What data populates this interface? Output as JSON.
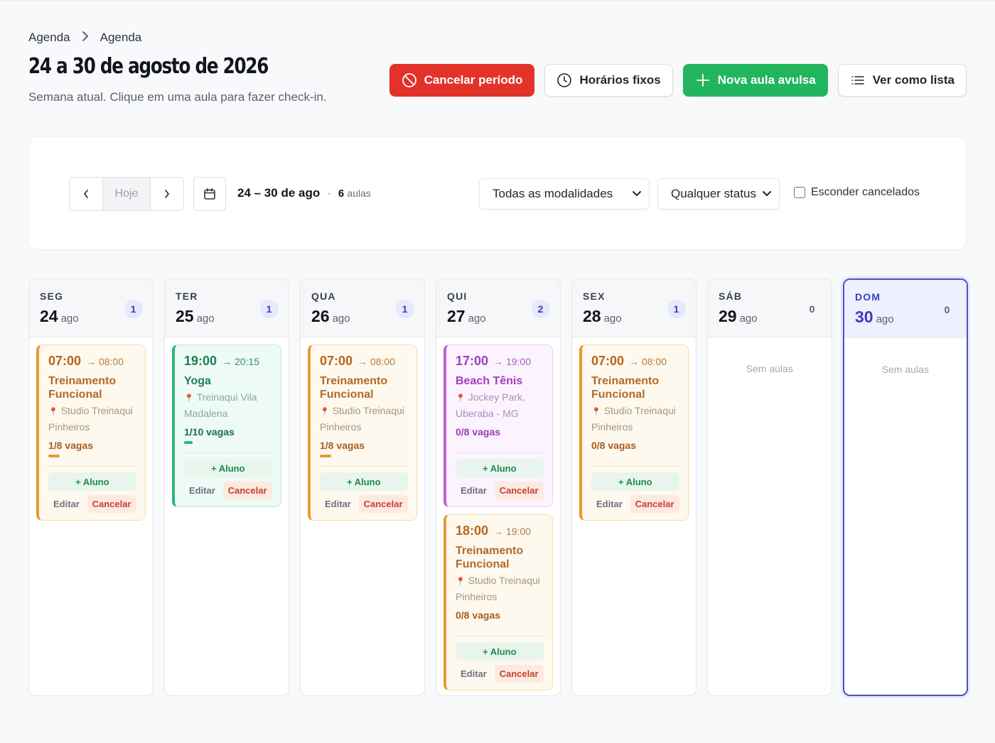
{
  "breadcrumb": {
    "root": "Agenda",
    "current": "Agenda"
  },
  "header": {
    "title": "24 a 30 de agosto de 2026",
    "subtitle": "Semana atual. Clique em uma aula para fazer check-in."
  },
  "actions": {
    "cancel_period": "Cancelar período",
    "fixed_hours": "Horários fixos",
    "new_class": "Nova aula avulsa",
    "view_list": "Ver como lista"
  },
  "filters": {
    "today": "Hoje",
    "range": "24 – 30 de ago",
    "separator": "·",
    "count_num": "6",
    "count_unit": "aulas",
    "modality": "Todas as modalidades",
    "status": "Qualquer status",
    "hide_cancelled": "Esconder cancelados"
  },
  "colors": {
    "accent": "#3a3ec0",
    "danger": "#e2322a",
    "success": "#22b55e",
    "orange": "#e69a34",
    "green": "#2fb57b",
    "purple": "#c45ed8"
  },
  "icons": {
    "cancel": "ban-icon",
    "clock": "clock-icon",
    "plus": "plus-icon",
    "list": "list-icon",
    "calendar": "calendar-icon",
    "prev": "chevron-left-icon",
    "next": "chevron-right-icon"
  },
  "labels": {
    "add_student": "+ Aluno",
    "edit": "Editar",
    "cancel": "Cancelar",
    "no_classes": "Sem aulas"
  },
  "days": [
    {
      "dow": "SEG",
      "num": "24",
      "month": "ago",
      "count": "1",
      "classes": [
        {
          "color": "orange",
          "start": "07:00",
          "end": "→ 08:00",
          "title": "Treinamento Funcional",
          "location": "Studio Treinaqui Pinheiros",
          "vagas": "1/8 vagas",
          "fill": 0.125
        }
      ]
    },
    {
      "dow": "TER",
      "num": "25",
      "month": "ago",
      "count": "1",
      "classes": [
        {
          "color": "green",
          "start": "19:00",
          "end": "→ 20:15",
          "title": "Yoga",
          "location": "Treinaqui Vila Madalena",
          "vagas": "1/10 vagas",
          "fill": 0.1
        }
      ]
    },
    {
      "dow": "QUA",
      "num": "26",
      "month": "ago",
      "count": "1",
      "classes": [
        {
          "color": "orange",
          "start": "07:00",
          "end": "→ 08:00",
          "title": "Treinamento Funcional",
          "location": "Studio Treinaqui Pinheiros",
          "vagas": "1/8 vagas",
          "fill": 0.125
        }
      ]
    },
    {
      "dow": "QUI",
      "num": "27",
      "month": "ago",
      "count": "2",
      "classes": [
        {
          "color": "purple",
          "start": "17:00",
          "end": "→ 19:00",
          "title": "Beach Tênis",
          "location": "Jockey Park, Uberaba - MG",
          "vagas": "0/8 vagas",
          "fill": 0
        },
        {
          "color": "orange",
          "start": "18:00",
          "end": "→ 19:00",
          "title": "Treinamento Funcional",
          "location": "Studio Treinaqui Pinheiros",
          "vagas": "0/8 vagas",
          "fill": 0
        }
      ]
    },
    {
      "dow": "SEX",
      "num": "28",
      "month": "ago",
      "count": "1",
      "classes": [
        {
          "color": "orange",
          "start": "07:00",
          "end": "→ 08:00",
          "title": "Treinamento Funcional",
          "location": "Studio Treinaqui Pinheiros",
          "vagas": "0/8 vagas",
          "fill": 0
        }
      ]
    },
    {
      "dow": "SÁB",
      "num": "29",
      "month": "ago",
      "count": "0",
      "classes": []
    },
    {
      "dow": "DOM",
      "num": "30",
      "month": "ago",
      "count": "0",
      "today": true,
      "classes": []
    }
  ]
}
